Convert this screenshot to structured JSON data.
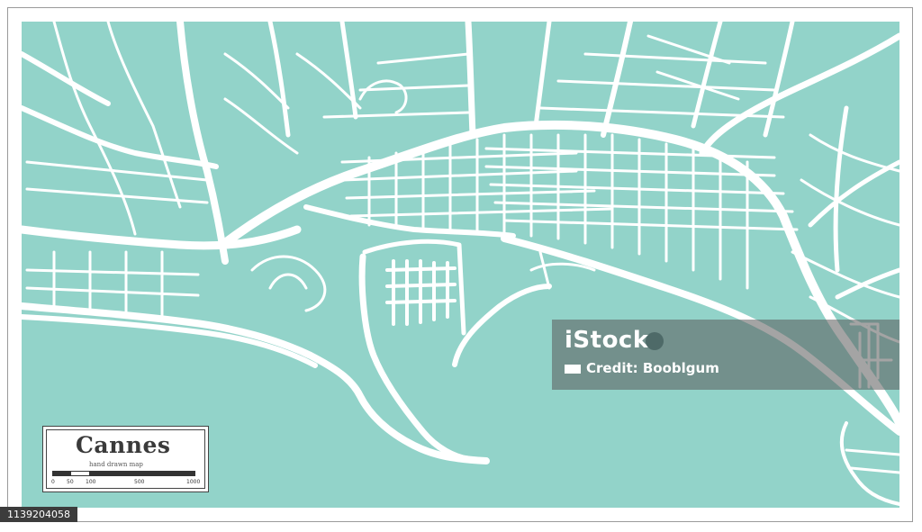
{
  "map": {
    "city_name": "Cannes",
    "subtitle": "hand drawn map",
    "colors": {
      "land": "#92d3c9",
      "sea": "#92d3c9",
      "roads": "#ffffff",
      "frame": "#9a9a9a"
    },
    "scale": {
      "ticks": [
        "0",
        "50",
        "100",
        "500",
        "1000"
      ]
    }
  },
  "watermark": {
    "logo_text": "iStock",
    "credit_text": "Credit: Booblgum"
  },
  "stock_id": "1139204058"
}
